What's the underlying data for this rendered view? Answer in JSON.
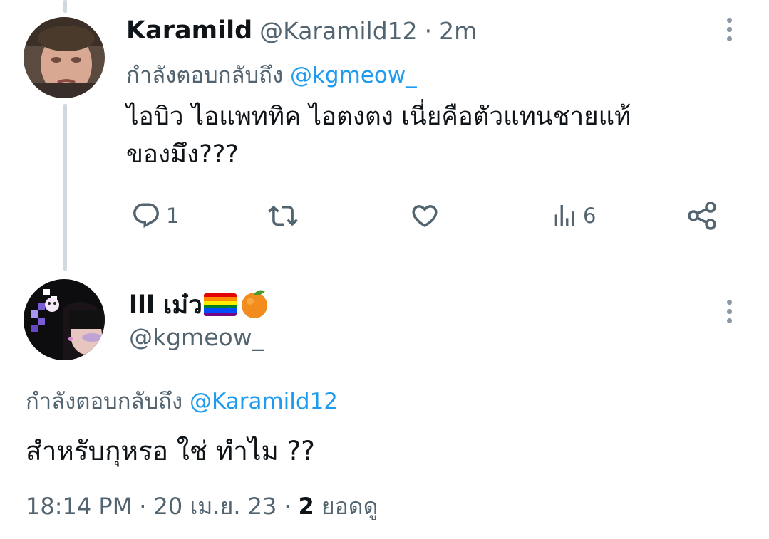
{
  "reply_tweet": {
    "display_name": "Karamild",
    "handle": "@Karamild12",
    "separator": "·",
    "time": "2m",
    "replying_prefix": "กำลังตอบกลับถึง",
    "replying_to": "@kgmeow_",
    "text_line1": "ไอบิว ไอแพททิค ไอตงตง เนี่ยคือตัวแทนชายแท้",
    "text_line2": "ของมึง???",
    "actions": {
      "reply_count": "1",
      "retweet_count": "",
      "like_count": "",
      "views_count": "6"
    }
  },
  "main_tweet": {
    "display_name": "lll เม๋ว",
    "name_emojis": [
      "rainbow-flag",
      "orange"
    ],
    "handle": "@kgmeow_",
    "replying_prefix": "กำลังตอบกลับถึง",
    "replying_to": "@Karamild12",
    "text": "สำหรับกุหรอ ใช่ ทำไม ??",
    "meta": {
      "time": "18:14 PM",
      "sep1": "·",
      "date": "20 เม.ย. 23",
      "sep2": "·",
      "views_number": "2",
      "views_label": "ยอดดู"
    }
  },
  "colors": {
    "link": "#1d9bf0",
    "muted": "#536471",
    "thread_line": "#cfd9de"
  }
}
